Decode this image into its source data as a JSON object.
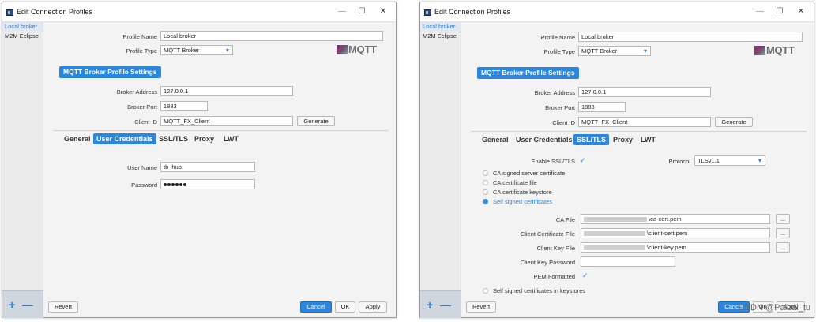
{
  "window": {
    "title": "Edit Connection Profiles",
    "minimize": "—",
    "maximize": "☐",
    "close": "✕"
  },
  "sidebar": {
    "items": [
      "Local broker",
      "M2M Eclipse"
    ],
    "add": "+",
    "remove": "—"
  },
  "profile": {
    "name_label": "Profile Name",
    "name_value": "Local broker",
    "type_label": "Profile Type",
    "type_value": "MQTT Broker",
    "logo_text": "MQTT"
  },
  "settings_header": "MQTT Broker Profile Settings",
  "broker": {
    "address_label": "Broker Address",
    "address_value": "127.0.0.1",
    "port_label": "Broker Port",
    "port_value": "1883",
    "client_id_label": "Client ID",
    "client_id_value": "MQTT_FX_Client",
    "generate": "Generate"
  },
  "tabs": [
    "General",
    "User Credentials",
    "SSL/TLS",
    "Proxy",
    "LWT"
  ],
  "credentials": {
    "user_label": "User Name",
    "user_value": "tb_hub",
    "password_label": "Password"
  },
  "ssl": {
    "enable_label": "Enable SSL/TLS",
    "enable_check": "✓",
    "protocol_label": "Protocol",
    "protocol_value": "TLSv1.1",
    "options": [
      "CA signed server certificate",
      "CA certificate file",
      "CA certificate keystore",
      "Self signed certificates"
    ],
    "ca_file_label": "CA File",
    "ca_file_value": "\\ca-cert.pem",
    "client_cert_label": "Client Certificate File",
    "client_cert_value": "\\client-cert.pem",
    "client_key_label": "Client Key File",
    "client_key_value": "\\client-key.pem",
    "client_key_pw_label": "Client Key Password",
    "pem_label": "PEM Formatted",
    "pem_check": "✓",
    "browse": "...",
    "keystore_option": "Self signed certificates in keystores"
  },
  "footer": {
    "revert": "Revert",
    "cancel": "Cancel",
    "ok": "OK",
    "apply": "Apply"
  },
  "watermark": "CSDN @Paibai_tu"
}
